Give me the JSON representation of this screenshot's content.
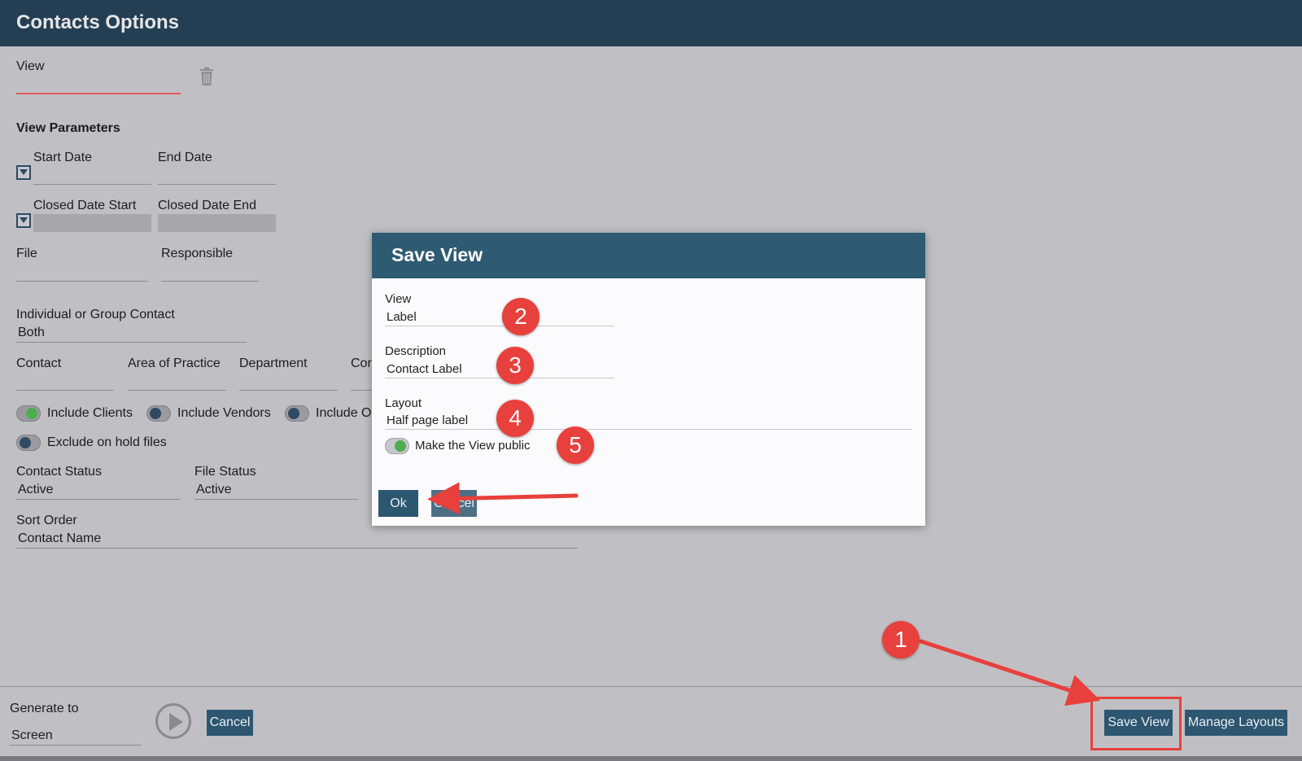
{
  "window": {
    "title": "Contacts Options"
  },
  "view": {
    "label": "View"
  },
  "parameters": {
    "heading": "View Parameters",
    "start_date": "Start Date",
    "end_date": "End Date",
    "closed_date_start": "Closed Date Start",
    "closed_date_end": "Closed Date End",
    "file": "File",
    "responsible": "Responsible",
    "individual_group_label": "Individual or Group Contact",
    "individual_group_value": "Both",
    "contact": "Contact",
    "area_of_practice": "Area of Practice",
    "department": "Department",
    "cor_truncated": "Cor",
    "include_clients": "Include Clients",
    "include_vendors": "Include Vendors",
    "include_other_truncated": "Include O",
    "exclude_on_hold": "Exclude on hold files",
    "contact_status_label": "Contact Status",
    "contact_status_value": "Active",
    "file_status_label": "File Status",
    "file_status_value": "Active",
    "sort_order_label": "Sort Order",
    "sort_order_value": "Contact Name"
  },
  "footer": {
    "generate_to_label": "Generate to",
    "generate_to_value": "Screen",
    "cancel": "Cancel",
    "save_view": "Save View",
    "manage_layouts": "Manage Layouts"
  },
  "modal": {
    "title": "Save View",
    "view_label": "View",
    "view_value": "Label",
    "description_label": "Description",
    "description_value": "Contact Label",
    "layout_label": "Layout",
    "layout_value": "Half page label",
    "make_public": "Make the View public",
    "ok": "Ok",
    "cancel": "Cancel"
  },
  "annotations": {
    "badges": [
      "1",
      "2",
      "3",
      "4",
      "5"
    ],
    "color": "#e8403c"
  },
  "colors": {
    "header": "#243f54",
    "modal_header": "#2e5a72",
    "toggle_on": "#4cae4c",
    "accent_red": "#e8403c"
  },
  "toggles": {
    "include_clients": true,
    "include_vendors": false,
    "include_other": false,
    "exclude_on_hold": false,
    "make_public": true
  }
}
